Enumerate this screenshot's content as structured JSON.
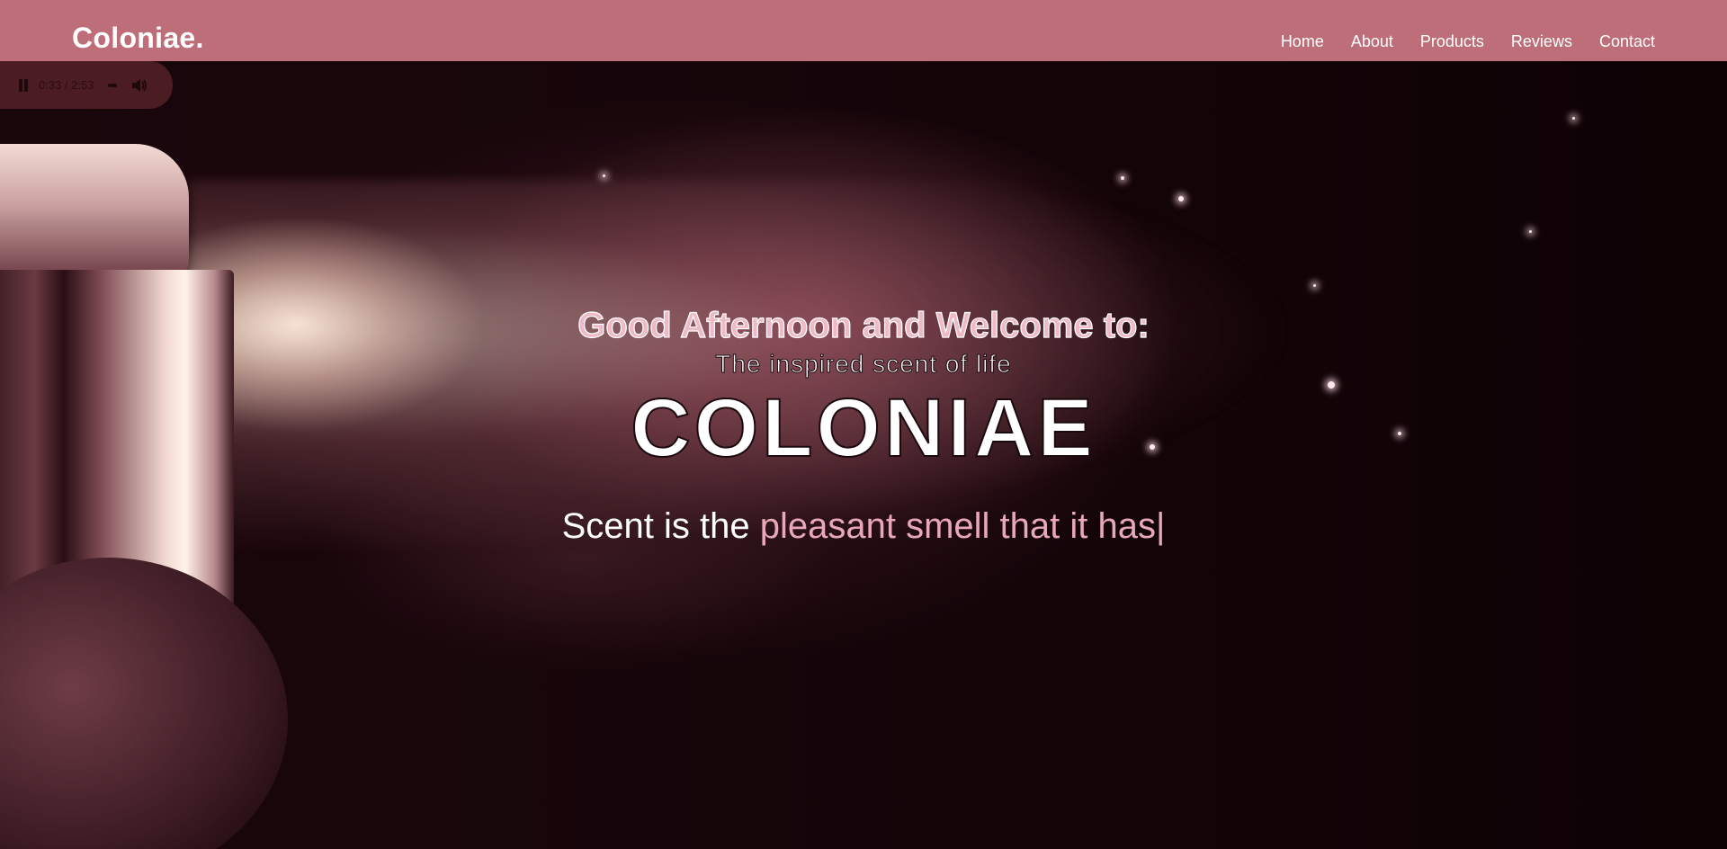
{
  "header": {
    "logo": "Coloniae.",
    "nav": [
      "Home",
      "About",
      "Products",
      "Reviews",
      "Contact"
    ]
  },
  "media": {
    "time": "0:33 / 2:53"
  },
  "hero": {
    "welcome": "Good Afternoon and Welcome to:",
    "tagline": "The inspired scent of life",
    "brand": "COLONIAE",
    "typing_static": "Scent is the",
    "typing_text": "pleasant smell that it has",
    "cursor": "|"
  },
  "colors": {
    "header_bg": "#bd6e79",
    "accent_text": "#f0b9c6",
    "typed_text": "#e8a8b8"
  }
}
